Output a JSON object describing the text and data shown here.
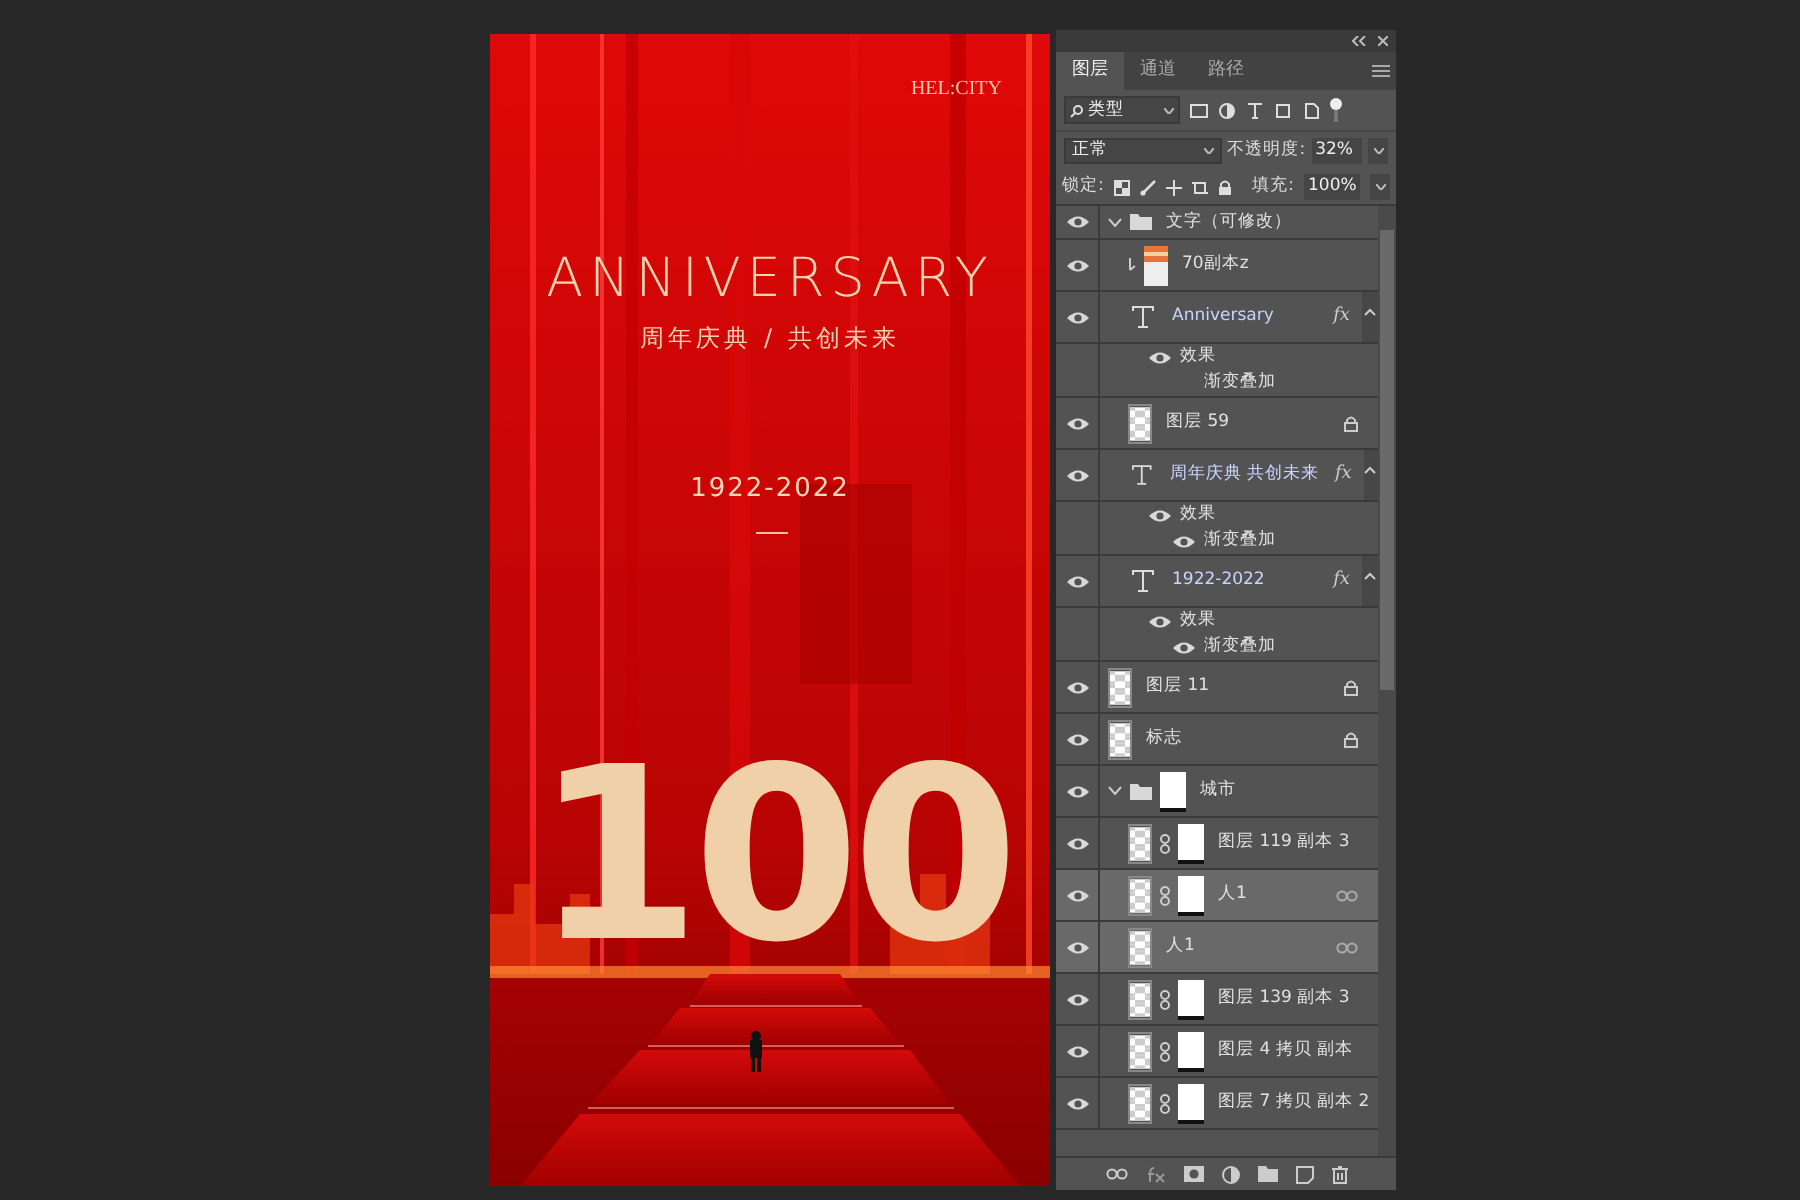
{
  "poster": {
    "brand": "HEL:CITY",
    "title": "ANNIVERSARY",
    "subtitle": "周年庆典 / 共创未来",
    "years": "1922-2022",
    "number": "100"
  },
  "layers_panel": {
    "tabs": [
      {
        "label": "图层",
        "selected": true
      },
      {
        "label": "通道",
        "selected": false
      },
      {
        "label": "路径",
        "selected": false
      }
    ],
    "filter": "类型",
    "blend_mode": "正常",
    "opacity_label": "不透明度:",
    "opacity": "32%",
    "lock_label": "锁定:",
    "fill_label": "填充:",
    "fill": "100%",
    "layers": [
      {
        "name": "文字（可修改）",
        "kind": "group",
        "visible": true,
        "selected": false,
        "expanded": true,
        "children": [
          {
            "name": "70副本z",
            "kind": "image",
            "visible": true,
            "selected": false,
            "clipped": true
          },
          {
            "name": "Anniversary",
            "kind": "text",
            "visible": true,
            "selected": false,
            "fx": "fx",
            "effects_title": "效果",
            "effects": [
              {
                "name": "渐变叠加",
                "visible": false
              }
            ]
          },
          {
            "name": "图层 59",
            "kind": "pixel",
            "visible": true,
            "selected": false,
            "locked": true
          },
          {
            "name": "周年庆典  共创未来",
            "kind": "text",
            "visible": true,
            "selected": false,
            "fx": "fx",
            "effects_title": "效果",
            "effects": [
              {
                "name": "渐变叠加",
                "visible": true
              }
            ]
          },
          {
            "name": "1922-2022",
            "kind": "text",
            "visible": true,
            "selected": false,
            "fx": "fx",
            "effects_title": "效果",
            "effects": [
              {
                "name": "渐变叠加",
                "visible": true
              }
            ]
          }
        ]
      },
      {
        "name": "图层 11",
        "kind": "pixel",
        "visible": true,
        "selected": false,
        "locked": true
      },
      {
        "name": "标志",
        "kind": "pixel",
        "visible": true,
        "selected": false,
        "locked": true
      },
      {
        "name": "城市",
        "kind": "group",
        "visible": true,
        "selected": false,
        "expanded": true,
        "mask": true,
        "children": [
          {
            "name": "图层 119 副本 3",
            "kind": "pixel",
            "visible": true,
            "selected": false,
            "mask": true
          },
          {
            "name": "人1",
            "kind": "pixel",
            "visible": true,
            "selected": true,
            "mask": true,
            "linked": true
          },
          {
            "name": "人1",
            "kind": "pixel",
            "visible": true,
            "selected": true,
            "linked": true
          },
          {
            "name": "图层 139 副本 3",
            "kind": "pixel",
            "visible": true,
            "selected": false,
            "mask": true
          },
          {
            "name": "图层 4 拷贝 副本",
            "kind": "pixel",
            "visible": true,
            "selected": false,
            "mask": true
          },
          {
            "name": "图层 7 拷贝 副本 2",
            "kind": "pixel",
            "visible": true,
            "selected": false,
            "mask": true
          }
        ]
      }
    ]
  }
}
